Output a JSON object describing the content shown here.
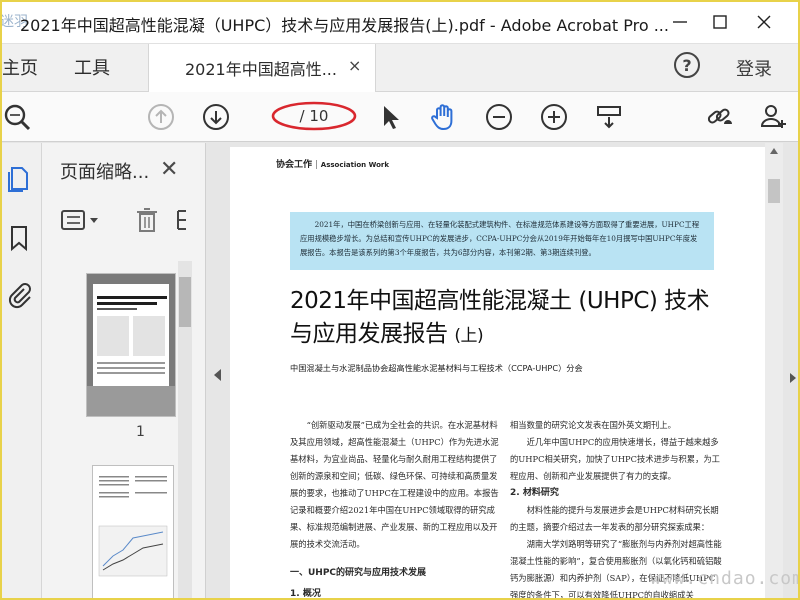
{
  "window": {
    "title": "2021年中国超高性能混凝（UHPC）技术与应用发展报告(上).pdf - Adobe Acrobat Pro ...",
    "logo_text": "迷羽网"
  },
  "tabs": {
    "home": "主页",
    "tools": "工具",
    "document": "2021年中国超高性...",
    "close_glyph": "×",
    "login": "登录"
  },
  "toolbar": {
    "page_indicator": "/ 10"
  },
  "thumbnails": {
    "title": "页面缩略...",
    "close_glyph": "✕",
    "page_number": "1"
  },
  "document": {
    "section_head_cn": "协会工作",
    "section_head_en": "Association Work",
    "intro": "2021年，中国在桥梁创新与应用、在轻量化装配式建筑构件、在标准规范体系建设等方面取得了重要进展，UHPC工程应用规模稳步增长。为总结和宣传UHPC的发展进步，CCPA-UHPC分会从2019年开始每年在10月撰写中国UHPC年度发展报告。本报告是该系列的第3个年度报告，共为6部分内容，本刊第2期、第3期连续刊登。",
    "title_line1": "2021年中国超高性能混凝土 (UHPC) 技术",
    "title_line2": "与应用发展报告",
    "title_suffix": "(上)",
    "org": "中国混凝土与水泥制品协会超高性能水泥基材料与工程技术（CCPA-UHPC）分会",
    "left_para": "“创新驱动发展”已成为全社会的共识。在水泥基材料及其应用领域，超高性能混凝土（UHPC）作为先进水泥基材料，为宜业尚品、轻量化与耐久耐用工程结构提供了创新的源泉和空间；低碳、绿色环保、可持续和高质量发展的要求，也推动了UHPC在工程建设中的应用。本报告记录和概要介绍2021年中国在UHPC领域取得的研究成果、标准规范编制进展、产业发展、新的工程应用以及开展的技术交流活动。",
    "left_h1": "一、UHPC的研究与应用技术发展",
    "left_h2": "1. 概况",
    "right_p1": "相当数量的研究论文发表在国外英文期刊上。",
    "right_p2": "近几年中国UHPC的应用快速增长，得益于越来越多的UHPC相关研究，加快了UHPC技术进步与积累，为工程应用、创新和产业发展提供了有力的支撑。",
    "right_h": "2. 材料研究",
    "right_p3": "材料性能的提升与发展进步会是UHPC材料研究长期的主题，摘要介绍过去一年发表的部分研究探索成果：",
    "right_p4": "湖南大学刘路明等研究了“膨胀剂与内养剂对超高性能混凝土性能的影响”，复合使用膨胀剂（以氧化钙和硫铝酸钙为膨胀源）和内养护剂（SAP），在保证不降低UHPC 强度的条件下，可以有效降低UHPC的自收缩成关"
  },
  "watermark": "www.cndao.com",
  "colors": {
    "accent_blue": "#2e6fd6",
    "highlight_box": "#b9e3f3",
    "annotation_red": "#d9272e"
  }
}
